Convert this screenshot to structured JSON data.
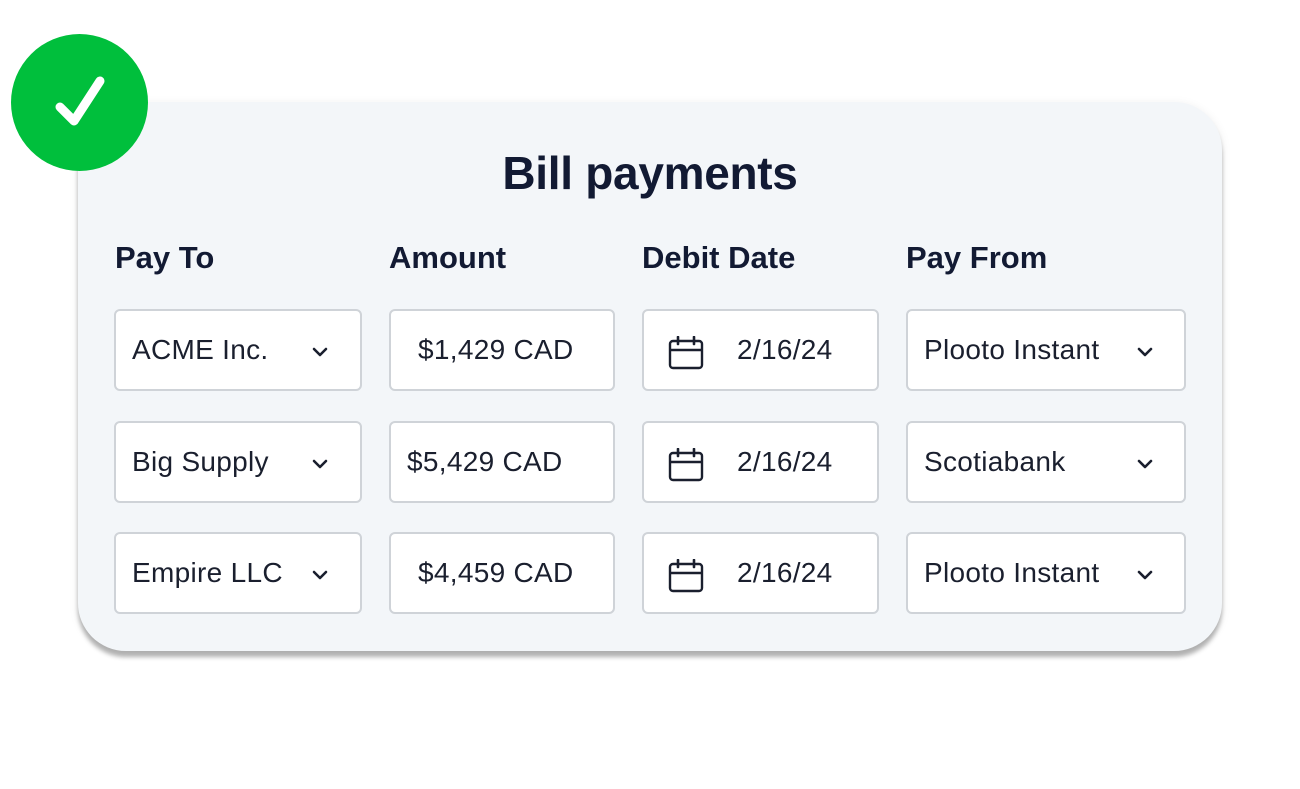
{
  "title": "Bill payments",
  "headers": {
    "pay_to": "Pay To",
    "amount": "Amount",
    "debit_date": "Debit Date",
    "pay_from": "Pay From"
  },
  "rows": [
    {
      "pay_to": "ACME Inc.",
      "amount": "$1,429 CAD",
      "debit_date": "2/16/24",
      "pay_from": "Plooto Instant"
    },
    {
      "pay_to": "Big Supply",
      "amount": "$5,429 CAD",
      "debit_date": "2/16/24",
      "pay_from": "Scotiabank"
    },
    {
      "pay_to": "Empire LLC",
      "amount": "$4,459 CAD",
      "debit_date": "2/16/24",
      "pay_from": "Plooto Instant"
    }
  ],
  "icons": {
    "badge": "checkmark-icon",
    "dropdown": "chevron-down-icon",
    "date": "calendar-icon"
  },
  "colors": {
    "badge": "#00bf3c",
    "card_background": "#f3f6f9",
    "text": "#121a33",
    "field_border": "#cfd3d8"
  }
}
